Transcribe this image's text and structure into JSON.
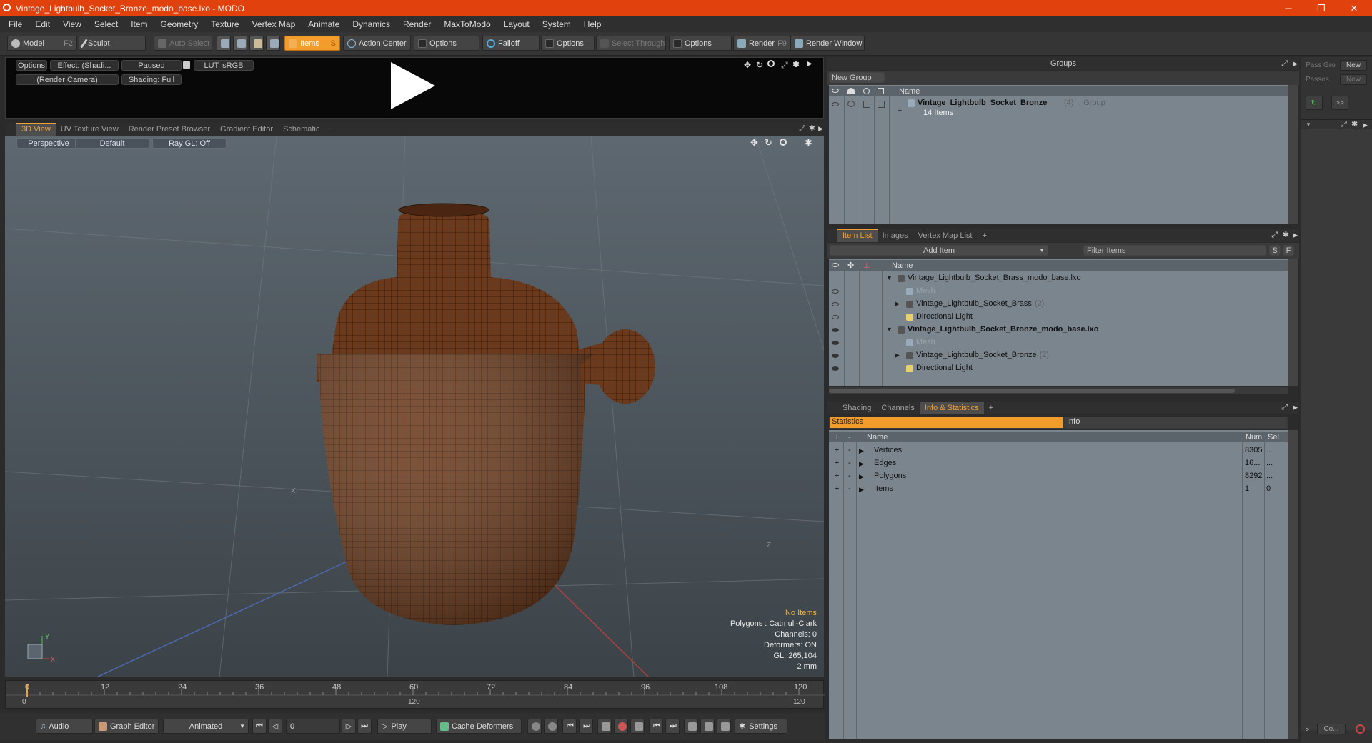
{
  "window": {
    "title": "Vintage_Lightbulb_Socket_Bronze_modo_base.lxo - MODO",
    "minimize": "─",
    "maximize": "❐",
    "close": "✕"
  },
  "menu": [
    "File",
    "Edit",
    "View",
    "Select",
    "Item",
    "Geometry",
    "Texture",
    "Vertex Map",
    "Animate",
    "Dynamics",
    "Render",
    "MaxToModo",
    "Layout",
    "System",
    "Help"
  ],
  "toolbar": {
    "model": "Model",
    "model_key": "F2",
    "sculpt": "Sculpt",
    "auto_select": "Auto Select",
    "items": "Items",
    "items_key": "S",
    "action_center": "Action Center",
    "options1": "Options",
    "falloff": "Falloff",
    "options2": "Options",
    "select_through": "Select Through",
    "options3": "Options",
    "render": "Render",
    "render_key": "F9",
    "render_window": "Render Window"
  },
  "preview": {
    "options": "Options",
    "effect": "Effect: (Shadi...",
    "paused": "Paused",
    "lut": "LUT: sRGB",
    "camera": "(Render Camera)",
    "shading": "Shading: Full"
  },
  "view_tabs": [
    "3D View",
    "UV Texture View",
    "Render Preset Browser",
    "Gradient Editor",
    "Schematic",
    "+"
  ],
  "viewport": {
    "perspective": "Perspective",
    "default": "Default",
    "raygl": "Ray GL: Off",
    "no_items": "No Items",
    "polygons": "Polygons : Catmull-Clark",
    "channels": "Channels: 0",
    "deformers": "Deformers: ON",
    "gl": "GL: 265,104",
    "scale": "2 mm",
    "axis_y": "Y",
    "axis_x": "X",
    "axis_z": "Z",
    "axis_x2": "X",
    "axis_z2": "Z"
  },
  "timeline": {
    "ticks": [
      "0",
      "12",
      "24",
      "36",
      "48",
      "60",
      "72",
      "84",
      "96",
      "108",
      "120"
    ],
    "range_start": "0",
    "range_mid": "120",
    "range_end": "120"
  },
  "bottom": {
    "audio": "Audio",
    "graph_editor": "Graph Editor",
    "animated": "Animated",
    "frame": "0",
    "play": "Play",
    "cache_deformers": "Cache Deformers",
    "settings": "Settings"
  },
  "groups": {
    "title": "Groups",
    "new_group": "New Group",
    "col_name": "Name",
    "group_name": "Vintage_Lightbulb_Socket_Bronze",
    "group_count": "(4)",
    "group_type": ": Group",
    "group_items": "14 Items"
  },
  "side": {
    "pass_groups": "Pass Gro",
    "new1": "New",
    "passes": "Passes",
    "new2": "New",
    "arrows": ">>",
    "co": "Co..."
  },
  "itemlist": {
    "tabs": [
      "Item List",
      "Images",
      "Vertex Map List",
      "+"
    ],
    "add_item": "Add Item",
    "filter": "Filter Items",
    "s": "S",
    "f": "F",
    "col_name": "Name",
    "rows": [
      {
        "label": "Vintage_Lightbulb_Socket_Brass_modo_base.lxo",
        "extra": "",
        "bold": false,
        "dim": false
      },
      {
        "label": "Mesh",
        "extra": "",
        "bold": false,
        "dim": true
      },
      {
        "label": "Vintage_Lightbulb_Socket_Brass",
        "extra": "(2)",
        "bold": false,
        "dim": false
      },
      {
        "label": "Directional Light",
        "extra": "",
        "bold": false,
        "dim": false
      },
      {
        "label": "Vintage_Lightbulb_Socket_Bronze_modo_base.lxo",
        "extra": "",
        "bold": true,
        "dim": false
      },
      {
        "label": "Mesh",
        "extra": "",
        "bold": false,
        "dim": true
      },
      {
        "label": "Vintage_Lightbulb_Socket_Bronze",
        "extra": "(2)",
        "bold": false,
        "dim": false
      },
      {
        "label": "Directional Light",
        "extra": "",
        "bold": false,
        "dim": false
      }
    ]
  },
  "stats": {
    "tabs": [
      "Shading",
      "Channels",
      "Info & Statistics",
      "+"
    ],
    "statistics": "Statistics",
    "info": "Info",
    "col_name": "Name",
    "col_num": "Num",
    "col_sel": "Sel",
    "rows": [
      {
        "name": "Vertices",
        "num": "8305",
        "sel": "..."
      },
      {
        "name": "Edges",
        "num": "16...",
        "sel": "..."
      },
      {
        "name": "Polygons",
        "num": "8292",
        "sel": "..."
      },
      {
        "name": "Items",
        "num": "1",
        "sel": "0"
      }
    ]
  },
  "colors": {
    "title": "#e0410d",
    "accent": "#f29c2b",
    "panel": "#7b858d",
    "mesh": "#6b3a1c"
  }
}
